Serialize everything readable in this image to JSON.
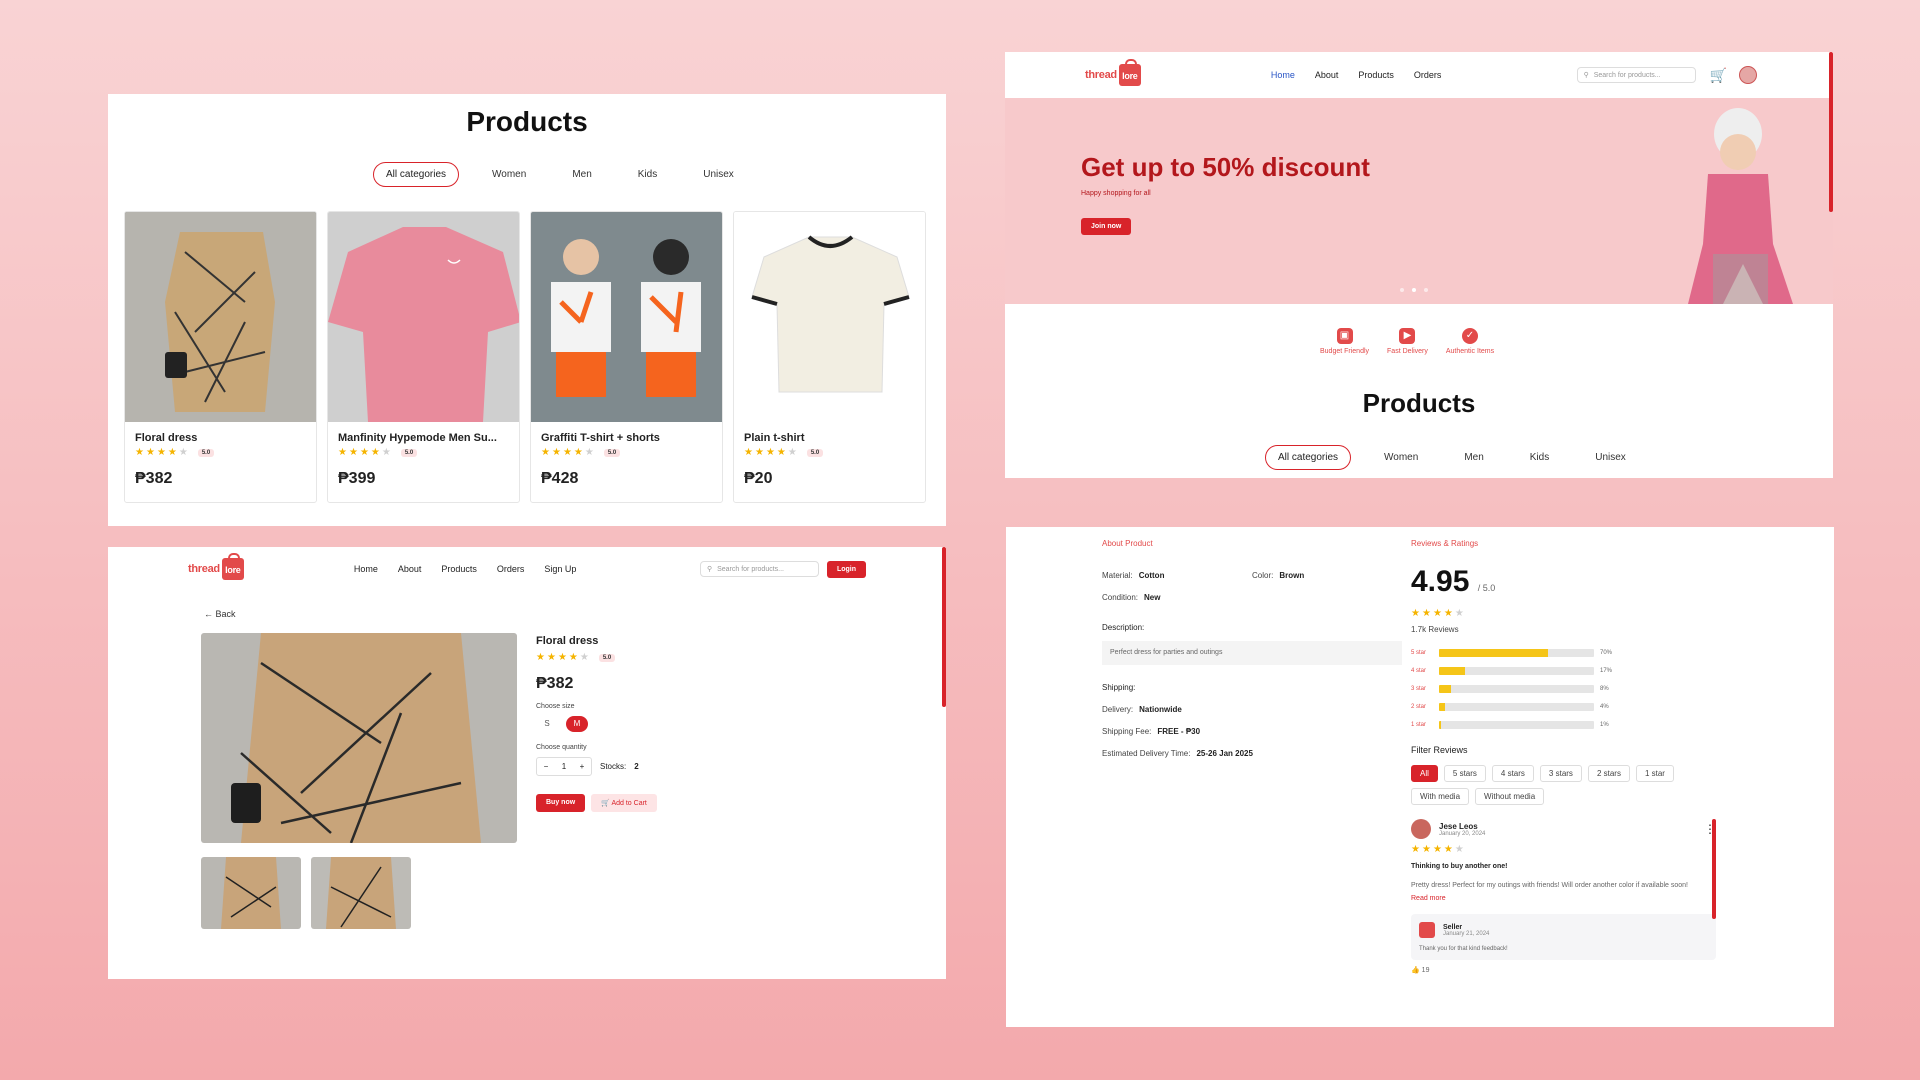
{
  "brand": {
    "name_a": "thread",
    "name_b": "lore"
  },
  "colors": {
    "accent": "#d8232a",
    "hero_bg": "#f7c9cb",
    "star": "#f5b400"
  },
  "catalog": {
    "title": "Products",
    "categories": [
      "All categories",
      "Women",
      "Men",
      "Kids",
      "Unisex"
    ],
    "active_category": "All categories",
    "products": [
      {
        "name": "Floral dress",
        "rating": "5.0",
        "stars": 4,
        "price": "₱382"
      },
      {
        "name": "Manfinity Hypemode Men Su...",
        "rating": "5.0",
        "stars": 4,
        "price": "₱399"
      },
      {
        "name": "Graffiti T-shirt + shorts",
        "rating": "5.0",
        "stars": 4,
        "price": "₱428"
      },
      {
        "name": "Plain t-shirt",
        "rating": "5.0",
        "stars": 4,
        "price": "₱20"
      }
    ]
  },
  "home": {
    "nav": [
      "Home",
      "About",
      "Products",
      "Orders"
    ],
    "active_nav": "Home",
    "search_placeholder": "Search for products...",
    "hero_title": "Get up to 50% discount",
    "hero_sub": "Happy shopping for all",
    "hero_button": "Join now",
    "features": [
      "Budget Friendly",
      "Fast Delivery",
      "Authentic Items"
    ],
    "section_title": "Products"
  },
  "detail": {
    "nav": [
      "Home",
      "About",
      "Products",
      "Orders",
      "Sign Up"
    ],
    "search_placeholder": "Search for products...",
    "login": "Login",
    "back": "Back",
    "name": "Floral dress",
    "rating": "5.0",
    "price": "₱382",
    "choose_size": "Choose size",
    "sizes": [
      "S",
      "M"
    ],
    "selected_size": "M",
    "choose_qty": "Choose quantity",
    "qty": "1",
    "stocks_label": "Stocks:",
    "stocks": "2",
    "buy": "Buy now",
    "cart": "Add to Cart"
  },
  "reviews": {
    "about_title": "About Product",
    "material_label": "Material:",
    "material": "Cotton",
    "color_label": "Color:",
    "color": "Brown",
    "condition_label": "Condition:",
    "condition": "New",
    "desc_label": "Description:",
    "desc": "Perfect dress for parties and outings",
    "shipping_label": "Shipping:",
    "delivery_label": "Delivery:",
    "delivery": "Nationwide",
    "fee_label": "Shipping Fee:",
    "fee": "FREE - ₱30",
    "eta_label": "Estimated Delivery Time:",
    "eta": "25-26 Jan 2025",
    "ratings_title": "Reviews & Ratings",
    "score": "4.95",
    "score_of": "/ 5.0",
    "count": "1.7k Reviews",
    "breakdown": [
      {
        "label": "5 star",
        "pct": "70%",
        "value": 70
      },
      {
        "label": "4 star",
        "pct": "17%",
        "value": 17
      },
      {
        "label": "3 star",
        "pct": "8%",
        "value": 8
      },
      {
        "label": "2 star",
        "pct": "4%",
        "value": 4
      },
      {
        "label": "1 star",
        "pct": "1%",
        "value": 1
      }
    ],
    "filter_title": "Filter Reviews",
    "filters": [
      "All",
      "5 stars",
      "4 stars",
      "3 stars",
      "2 stars",
      "1 star",
      "With media",
      "Without media"
    ],
    "reviewer": "Jese Leos",
    "review_date": "January 20, 2024",
    "review_title": "Thinking to buy another one!",
    "review_text": "Pretty dress! Perfect for my outings with friends! Will order another color if available soon!",
    "read_more": "Read more",
    "seller": "Seller",
    "seller_date": "January 21, 2024",
    "seller_text": "Thank you for that kind feedback!",
    "likes": "19"
  }
}
